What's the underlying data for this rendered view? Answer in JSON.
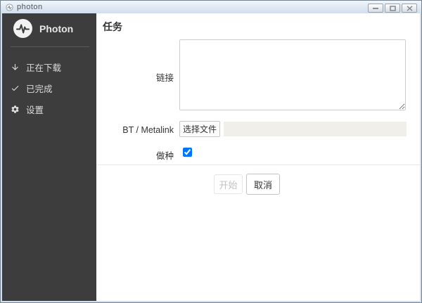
{
  "window": {
    "title": "photon",
    "controls": {
      "minimize": "minimize",
      "maximize": "maximize",
      "close": "close"
    }
  },
  "sidebar": {
    "app_name": "Photon",
    "items": [
      {
        "icon": "download-arrow",
        "label": "正在下载"
      },
      {
        "icon": "check",
        "label": "已完成"
      },
      {
        "icon": "gear",
        "label": "设置"
      }
    ]
  },
  "main": {
    "title": "任务",
    "form": {
      "link_label": "链接",
      "link_value": "",
      "bt_label": "BT / Metalink",
      "choose_file_button": "选择文件",
      "file_value": "",
      "seed_label": "做种",
      "seed_checked": true
    },
    "actions": {
      "start": "开始",
      "cancel": "取消"
    }
  },
  "colors": {
    "sidebar_bg": "#3d3d3d",
    "sidebar_text": "#dcdcdc",
    "titlebar_top": "#eff5fb",
    "titlebar_bottom": "#d2deec",
    "main_bg": "#ffffff",
    "label_text": "#333333",
    "disabled_button_text": "#c2c2c2",
    "file_field_bg": "#f0efe9",
    "divider": "#e8e8e8"
  }
}
